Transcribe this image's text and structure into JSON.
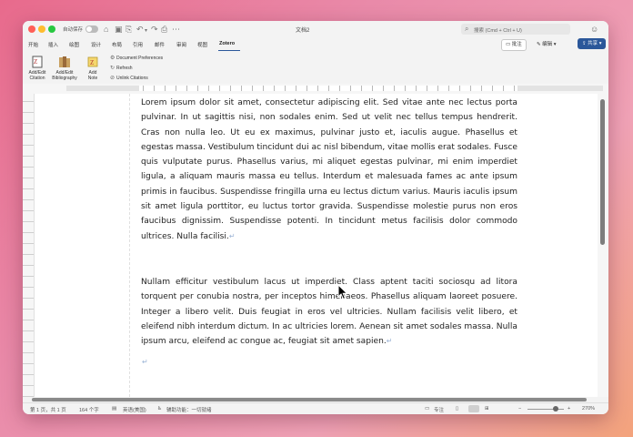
{
  "titlebar": {
    "autosave_label": "自动保存",
    "doc_title": "文档2",
    "search_placeholder": "搜索 (Cmd + Ctrl + U)"
  },
  "tabs": [
    {
      "label": "开始"
    },
    {
      "label": "插入"
    },
    {
      "label": "绘图"
    },
    {
      "label": "设计"
    },
    {
      "label": "布局"
    },
    {
      "label": "引用"
    },
    {
      "label": "邮件"
    },
    {
      "label": "审阅"
    },
    {
      "label": "视图"
    },
    {
      "label": "Zotero",
      "active": true
    }
  ],
  "header_buttons": {
    "comment": "批注",
    "edit": "编辑",
    "share": "共享"
  },
  "ribbon": {
    "add_edit_citation": [
      "Add/Edit",
      "Citation"
    ],
    "add_edit_bibliography": [
      "Add/Edit",
      "Bibliography"
    ],
    "add_note": [
      "Add",
      "Note"
    ],
    "document_preferences": "Document Preferences",
    "refresh": "Refresh",
    "unlink_citations": "Unlink Citations"
  },
  "document": {
    "paragraphs": [
      "Lorem ipsum dolor sit amet, consectetur adipiscing elit. Sed vitae ante nec lectus porta pulvinar. In ut sagittis nisi, non sodales enim. Sed ut velit nec tellus tempus hendrerit. Cras non nulla leo. Ut eu ex maximus, pulvinar justo et, iaculis augue. Phasellus et egestas massa. Vestibulum tincidunt dui ac nisl bibendum, vitae mollis erat sodales. Fusce quis vulputate purus. Phasellus varius, mi aliquet egestas pulvinar, mi enim imperdiet ligula, a aliquam mauris massa eu tellus. Interdum et malesuada fames ac ante ipsum primis in faucibus. Suspendisse fringilla urna eu lectus dictum varius. Mauris iaculis ipsum sit amet ligula porttitor, eu luctus tortor gravida. Suspendisse molestie purus non eros faucibus dignissim. Suspendisse potenti. In tincidunt metus facilisis dolor commodo ultrices. Nulla facilisi.",
      "Nullam efficitur vestibulum lacus ut imperdiet. Class aptent taciti sociosqu ad litora torquent per conubia nostra, per inceptos himenaeos. Phasellus aliquam laoreet posuere. Integer a libero velit. Duis feugiat in eros vel ultricies. Nullam facilisis velit libero, et eleifend nibh interdum dictum. In ac ultricies lorem. Aenean sit amet sodales massa. Nulla ipsum arcu, eleifend ac congue ac, feugiat sit amet sapien."
    ],
    "paragraph_mark": "↵"
  },
  "statusbar": {
    "page": "第 1 页，共 1 页",
    "words": "164 个字",
    "language": "英语(美国)",
    "accessibility": "辅助功能：一切就绪",
    "focus": "专注",
    "zoom": "270%"
  }
}
